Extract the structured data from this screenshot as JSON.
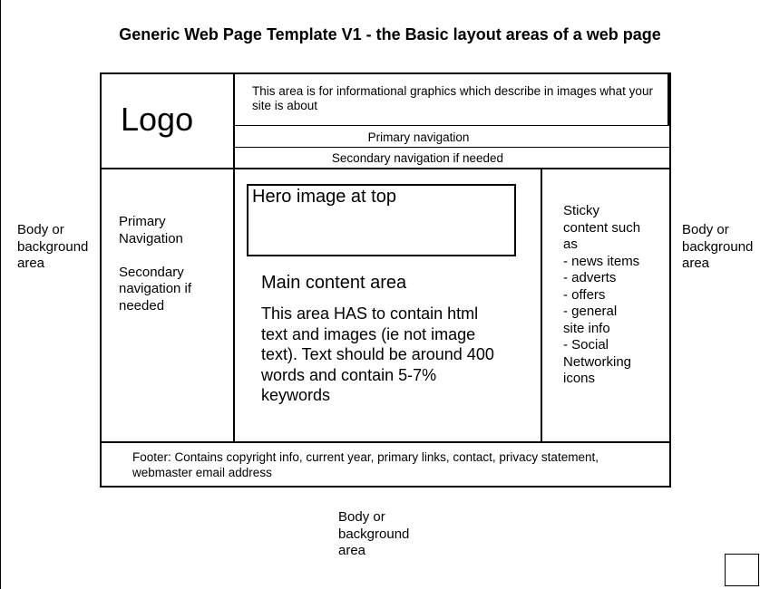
{
  "title": "Generic Web Page Template V1 - the Basic layout areas of a web page",
  "body_area": {
    "left": [
      "Body or",
      "background",
      "area"
    ],
    "right": [
      "Body or",
      "background",
      "area"
    ],
    "bottom": [
      "Body or",
      "background",
      "area"
    ]
  },
  "header": {
    "logo": "Logo",
    "info_graphics": "This area is for informational graphics which describe in images what your site is about",
    "primary_nav": "Primary navigation",
    "secondary_nav": "Secondary navigation if needed"
  },
  "left_sidebar": {
    "primary": [
      "Primary",
      "Navigation"
    ],
    "secondary": [
      "Secondary",
      "navigation if",
      "needed"
    ]
  },
  "main": {
    "hero": "Hero image at top",
    "title": "Main content area",
    "body": "This area HAS to contain html text and images (ie not image text). Text should be around 400 words and contain 5-7% keywords"
  },
  "right_sidebar": {
    "lines": [
      "Sticky",
      "content such",
      "as",
      "- news items",
      "- adverts",
      "- offers",
      "- general",
      "site info",
      "- Social",
      "Networking",
      "icons"
    ]
  },
  "footer": {
    "text": "Footer: Contains copyright info, current year, primary links, contact, privacy statement, webmaster email address"
  }
}
